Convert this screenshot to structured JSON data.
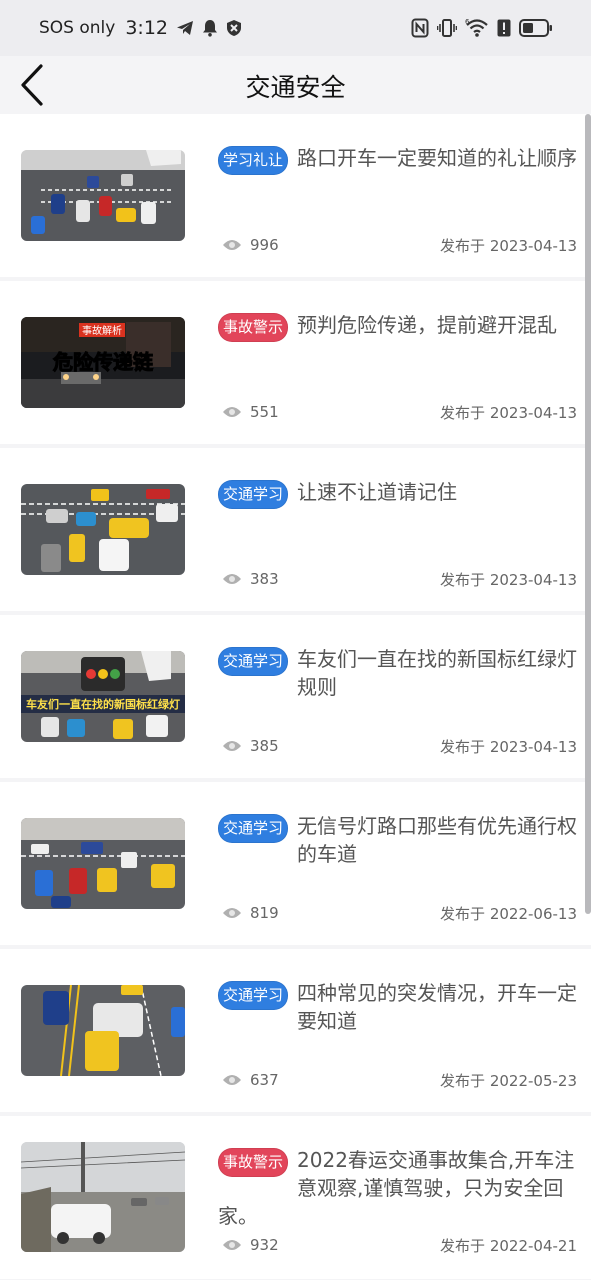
{
  "status_bar": {
    "carrier": "SOS only",
    "time": "3:12",
    "icons": [
      "telegram-icon",
      "bell-icon",
      "shield-icon",
      "nfc-icon",
      "vibrate-icon",
      "wifi-icon",
      "alert-icon",
      "battery-icon"
    ]
  },
  "nav": {
    "back_icon": "chevron-left-icon",
    "title": "交通安全"
  },
  "colors": {
    "badge_blue": "#2f7ee0",
    "badge_red": "#e2455a",
    "background": "#f4f4f6"
  },
  "articles": [
    {
      "tag": "学习礼让",
      "tag_color": "blue",
      "title": "路口开车一定要知道的礼让顺序",
      "views": "996",
      "date": "发布于 2023-04-13",
      "thumb": "intersection"
    },
    {
      "tag": "事故警示",
      "tag_color": "red",
      "title": "预判危险传递，提前避开混乱",
      "views": "551",
      "date": "发布于 2023-04-13",
      "thumb": "dashcam",
      "thumb_caption_top": "事故解析",
      "thumb_caption_main": "危险传递链"
    },
    {
      "tag": "交通学习",
      "tag_color": "blue",
      "title": "让速不让道请记住",
      "views": "383",
      "date": "发布于 2023-04-13",
      "thumb": "intersection"
    },
    {
      "tag": "交通学习",
      "tag_color": "blue",
      "title": "车友们一直在找的新国标红绿灯规则",
      "views": "385",
      "date": "发布于 2023-04-13",
      "thumb": "traffic-light",
      "thumb_caption_main": "车友们一直在找的新国标红绿灯"
    },
    {
      "tag": "交通学习",
      "tag_color": "blue",
      "title": "无信号灯路口那些有优先通行权的车道",
      "views": "819",
      "date": "发布于 2022-06-13",
      "thumb": "intersection"
    },
    {
      "tag": "交通学习",
      "tag_color": "blue",
      "title": "四种常见的突发情况，开车一定要知道",
      "views": "637",
      "date": "发布于 2022-05-23",
      "thumb": "lanes"
    },
    {
      "tag": "事故警示",
      "tag_color": "red",
      "title": "2022春运交通事故集合,开车注意观察,谨慎驾驶，只为安全回家。",
      "views": "932",
      "date": "发布于 2022-04-21",
      "thumb": "road-crash"
    }
  ],
  "view_icon": "eye-icon"
}
